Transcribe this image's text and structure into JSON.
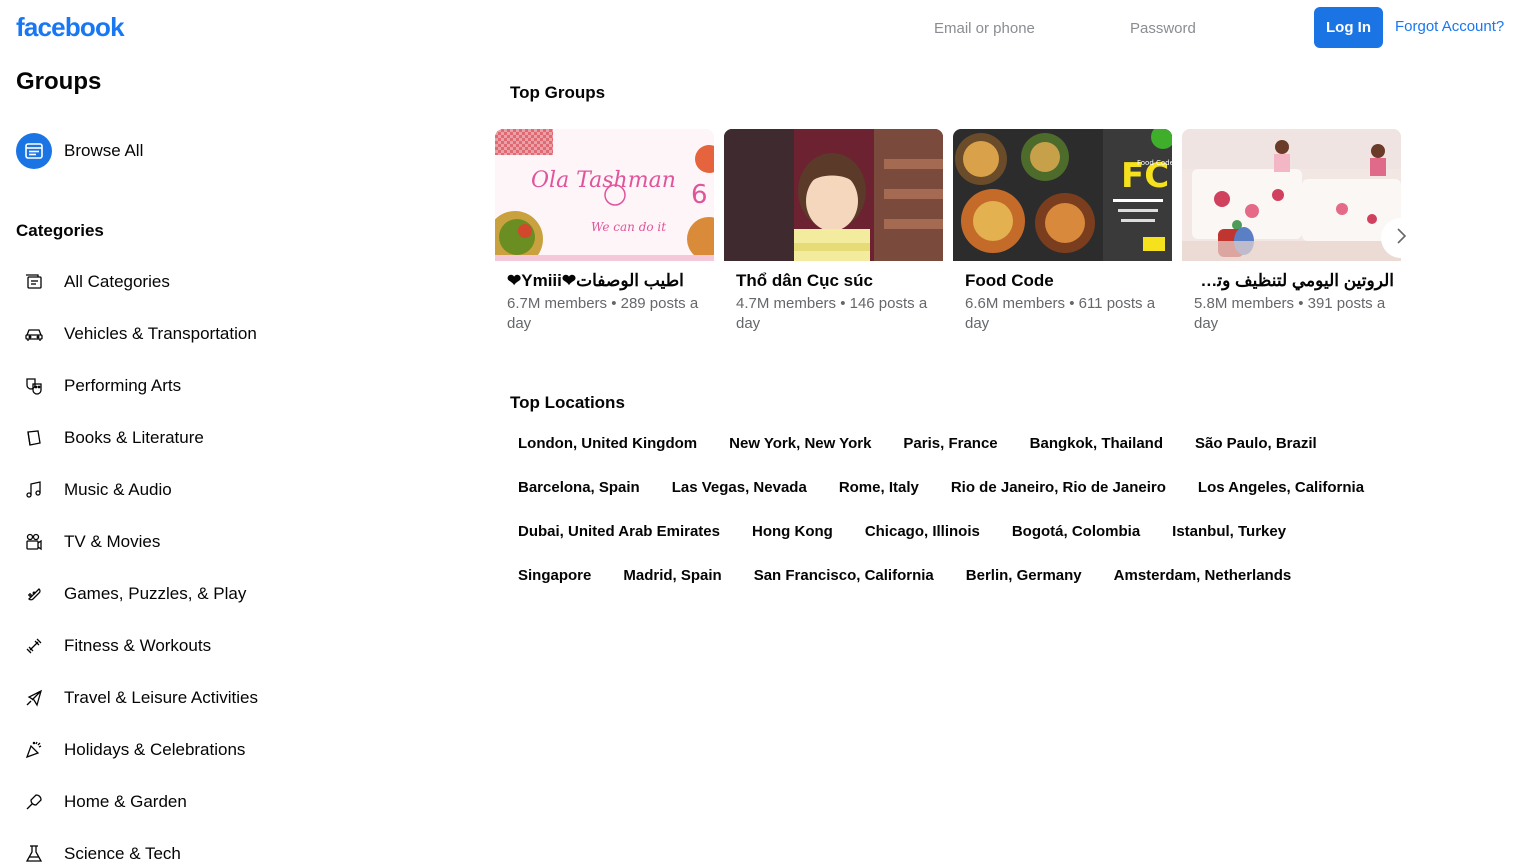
{
  "header": {
    "logo_text": "facebook",
    "email_placeholder": "Email or phone",
    "password_placeholder": "Password",
    "login_label": "Log In",
    "forgot_label": "Forgot Account?",
    "brand_color": "#1877f2"
  },
  "sidebar": {
    "title": "Groups",
    "browse_all": {
      "label": "Browse All",
      "icon": "browse-icon"
    },
    "categories_heading": "Categories",
    "categories": [
      {
        "label": "All Categories",
        "icon": "all-categories-icon"
      },
      {
        "label": "Vehicles & Transportation",
        "icon": "car-icon"
      },
      {
        "label": "Performing Arts",
        "icon": "theater-masks-icon"
      },
      {
        "label": "Books & Literature",
        "icon": "book-icon"
      },
      {
        "label": "Music & Audio",
        "icon": "music-note-icon"
      },
      {
        "label": "TV & Movies",
        "icon": "video-camera-icon"
      },
      {
        "label": "Games, Puzzles, & Play",
        "icon": "gamepad-icon"
      },
      {
        "label": "Fitness & Workouts",
        "icon": "dumbbell-icon"
      },
      {
        "label": "Travel & Leisure Activities",
        "icon": "airplane-icon"
      },
      {
        "label": "Holidays & Celebrations",
        "icon": "party-icon"
      },
      {
        "label": "Home & Garden",
        "icon": "shovel-icon"
      },
      {
        "label": "Science & Tech",
        "icon": "flask-icon"
      }
    ]
  },
  "top_groups": {
    "title": "Top Groups",
    "groups": [
      {
        "name": "❤Ymiii❤اطيب الوصفات",
        "stats": "6.7M members • 289 posts a day"
      },
      {
        "name": "Thổ dân Cục súc",
        "stats": "4.7M members • 146 posts a day"
      },
      {
        "name": "Food Code",
        "stats": "6.6M members • 611 posts a day"
      },
      {
        "name": "الروتين اليومي لتنظيف وترتيب المنزل",
        "stats": "5.8M members • 391 posts a day"
      }
    ]
  },
  "top_locations": {
    "title": "Top Locations",
    "rows": [
      [
        "London, United Kingdom",
        "New York, New York",
        "Paris, France",
        "Bangkok, Thailand",
        "São Paulo, Brazil"
      ],
      [
        "Barcelona, Spain",
        "Las Vegas, Nevada",
        "Rome, Italy",
        "Rio de Janeiro, Rio de Janeiro",
        "Los Angeles, California"
      ],
      [
        "Dubai, United Arab Emirates",
        "Hong Kong",
        "Chicago, Illinois",
        "Bogotá, Colombia",
        "Istanbul, Turkey"
      ],
      [
        "Singapore",
        "Madrid, Spain",
        "San Francisco, California",
        "Berlin, Germany",
        "Amsterdam, Netherlands"
      ]
    ]
  }
}
